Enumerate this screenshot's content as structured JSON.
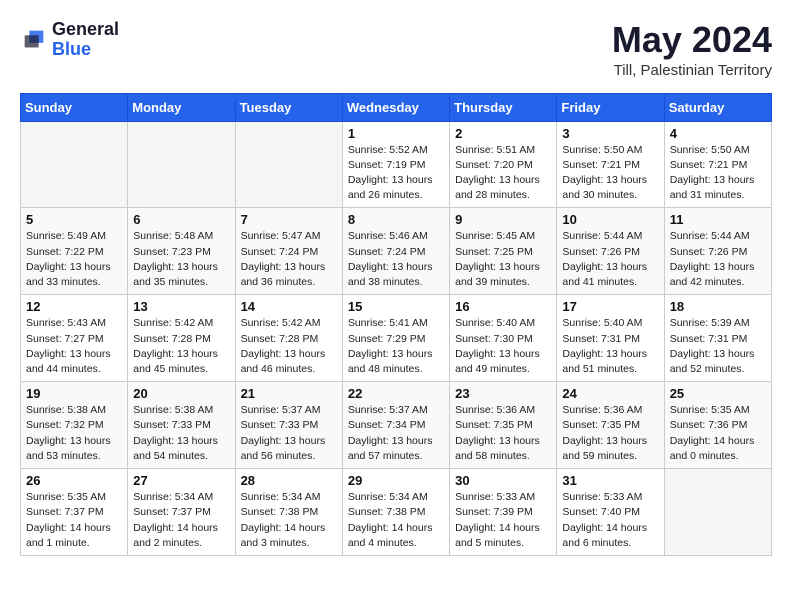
{
  "header": {
    "logo_general": "General",
    "logo_blue": "Blue",
    "month_title": "May 2024",
    "location": "Till, Palestinian Territory"
  },
  "days_of_week": [
    "Sunday",
    "Monday",
    "Tuesday",
    "Wednesday",
    "Thursday",
    "Friday",
    "Saturday"
  ],
  "weeks": [
    [
      {
        "day": "",
        "info": ""
      },
      {
        "day": "",
        "info": ""
      },
      {
        "day": "",
        "info": ""
      },
      {
        "day": "1",
        "sunrise": "Sunrise: 5:52 AM",
        "sunset": "Sunset: 7:19 PM",
        "daylight": "Daylight: 13 hours and 26 minutes."
      },
      {
        "day": "2",
        "sunrise": "Sunrise: 5:51 AM",
        "sunset": "Sunset: 7:20 PM",
        "daylight": "Daylight: 13 hours and 28 minutes."
      },
      {
        "day": "3",
        "sunrise": "Sunrise: 5:50 AM",
        "sunset": "Sunset: 7:21 PM",
        "daylight": "Daylight: 13 hours and 30 minutes."
      },
      {
        "day": "4",
        "sunrise": "Sunrise: 5:50 AM",
        "sunset": "Sunset: 7:21 PM",
        "daylight": "Daylight: 13 hours and 31 minutes."
      }
    ],
    [
      {
        "day": "5",
        "sunrise": "Sunrise: 5:49 AM",
        "sunset": "Sunset: 7:22 PM",
        "daylight": "Daylight: 13 hours and 33 minutes."
      },
      {
        "day": "6",
        "sunrise": "Sunrise: 5:48 AM",
        "sunset": "Sunset: 7:23 PM",
        "daylight": "Daylight: 13 hours and 35 minutes."
      },
      {
        "day": "7",
        "sunrise": "Sunrise: 5:47 AM",
        "sunset": "Sunset: 7:24 PM",
        "daylight": "Daylight: 13 hours and 36 minutes."
      },
      {
        "day": "8",
        "sunrise": "Sunrise: 5:46 AM",
        "sunset": "Sunset: 7:24 PM",
        "daylight": "Daylight: 13 hours and 38 minutes."
      },
      {
        "day": "9",
        "sunrise": "Sunrise: 5:45 AM",
        "sunset": "Sunset: 7:25 PM",
        "daylight": "Daylight: 13 hours and 39 minutes."
      },
      {
        "day": "10",
        "sunrise": "Sunrise: 5:44 AM",
        "sunset": "Sunset: 7:26 PM",
        "daylight": "Daylight: 13 hours and 41 minutes."
      },
      {
        "day": "11",
        "sunrise": "Sunrise: 5:44 AM",
        "sunset": "Sunset: 7:26 PM",
        "daylight": "Daylight: 13 hours and 42 minutes."
      }
    ],
    [
      {
        "day": "12",
        "sunrise": "Sunrise: 5:43 AM",
        "sunset": "Sunset: 7:27 PM",
        "daylight": "Daylight: 13 hours and 44 minutes."
      },
      {
        "day": "13",
        "sunrise": "Sunrise: 5:42 AM",
        "sunset": "Sunset: 7:28 PM",
        "daylight": "Daylight: 13 hours and 45 minutes."
      },
      {
        "day": "14",
        "sunrise": "Sunrise: 5:42 AM",
        "sunset": "Sunset: 7:28 PM",
        "daylight": "Daylight: 13 hours and 46 minutes."
      },
      {
        "day": "15",
        "sunrise": "Sunrise: 5:41 AM",
        "sunset": "Sunset: 7:29 PM",
        "daylight": "Daylight: 13 hours and 48 minutes."
      },
      {
        "day": "16",
        "sunrise": "Sunrise: 5:40 AM",
        "sunset": "Sunset: 7:30 PM",
        "daylight": "Daylight: 13 hours and 49 minutes."
      },
      {
        "day": "17",
        "sunrise": "Sunrise: 5:40 AM",
        "sunset": "Sunset: 7:31 PM",
        "daylight": "Daylight: 13 hours and 51 minutes."
      },
      {
        "day": "18",
        "sunrise": "Sunrise: 5:39 AM",
        "sunset": "Sunset: 7:31 PM",
        "daylight": "Daylight: 13 hours and 52 minutes."
      }
    ],
    [
      {
        "day": "19",
        "sunrise": "Sunrise: 5:38 AM",
        "sunset": "Sunset: 7:32 PM",
        "daylight": "Daylight: 13 hours and 53 minutes."
      },
      {
        "day": "20",
        "sunrise": "Sunrise: 5:38 AM",
        "sunset": "Sunset: 7:33 PM",
        "daylight": "Daylight: 13 hours and 54 minutes."
      },
      {
        "day": "21",
        "sunrise": "Sunrise: 5:37 AM",
        "sunset": "Sunset: 7:33 PM",
        "daylight": "Daylight: 13 hours and 56 minutes."
      },
      {
        "day": "22",
        "sunrise": "Sunrise: 5:37 AM",
        "sunset": "Sunset: 7:34 PM",
        "daylight": "Daylight: 13 hours and 57 minutes."
      },
      {
        "day": "23",
        "sunrise": "Sunrise: 5:36 AM",
        "sunset": "Sunset: 7:35 PM",
        "daylight": "Daylight: 13 hours and 58 minutes."
      },
      {
        "day": "24",
        "sunrise": "Sunrise: 5:36 AM",
        "sunset": "Sunset: 7:35 PM",
        "daylight": "Daylight: 13 hours and 59 minutes."
      },
      {
        "day": "25",
        "sunrise": "Sunrise: 5:35 AM",
        "sunset": "Sunset: 7:36 PM",
        "daylight": "Daylight: 14 hours and 0 minutes."
      }
    ],
    [
      {
        "day": "26",
        "sunrise": "Sunrise: 5:35 AM",
        "sunset": "Sunset: 7:37 PM",
        "daylight": "Daylight: 14 hours and 1 minute."
      },
      {
        "day": "27",
        "sunrise": "Sunrise: 5:34 AM",
        "sunset": "Sunset: 7:37 PM",
        "daylight": "Daylight: 14 hours and 2 minutes."
      },
      {
        "day": "28",
        "sunrise": "Sunrise: 5:34 AM",
        "sunset": "Sunset: 7:38 PM",
        "daylight": "Daylight: 14 hours and 3 minutes."
      },
      {
        "day": "29",
        "sunrise": "Sunrise: 5:34 AM",
        "sunset": "Sunset: 7:38 PM",
        "daylight": "Daylight: 14 hours and 4 minutes."
      },
      {
        "day": "30",
        "sunrise": "Sunrise: 5:33 AM",
        "sunset": "Sunset: 7:39 PM",
        "daylight": "Daylight: 14 hours and 5 minutes."
      },
      {
        "day": "31",
        "sunrise": "Sunrise: 5:33 AM",
        "sunset": "Sunset: 7:40 PM",
        "daylight": "Daylight: 14 hours and 6 minutes."
      },
      {
        "day": "",
        "info": ""
      }
    ]
  ]
}
